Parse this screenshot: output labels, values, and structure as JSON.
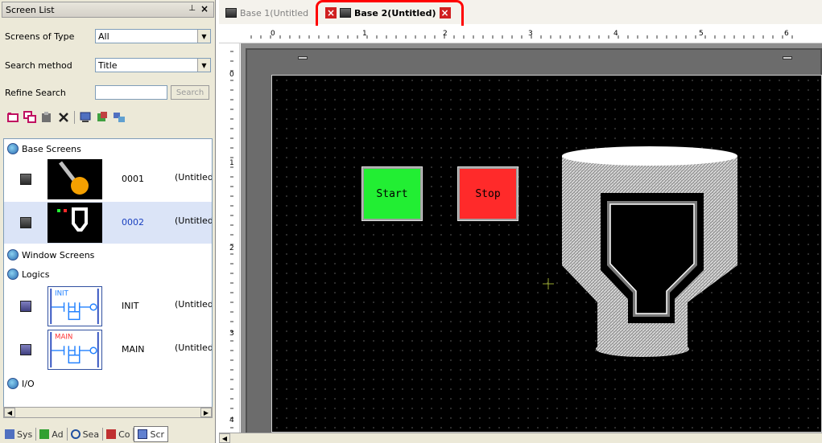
{
  "screen_list": {
    "title": "Screen List",
    "pin_icon": "pin-icon",
    "close_label": "×",
    "screens_of_type_label": "Screens of Type",
    "screens_of_type_value": "All",
    "search_method_label": "Search method",
    "search_method_value": "Title",
    "refine_search_label": "Refine Search",
    "refine_search_value": "",
    "search_button": "Search",
    "sections": {
      "base": "Base Screens",
      "window": "Window Screens",
      "logics": "Logics",
      "io": "I/O"
    },
    "base_screens": [
      {
        "number": "0001",
        "title": "(Untitled)"
      },
      {
        "number": "0002",
        "title": "(Untitled)"
      }
    ],
    "logics": [
      {
        "number": "INIT",
        "title": "(Untitled)",
        "thumb_label": "INIT"
      },
      {
        "number": "MAIN",
        "title": "(Untitled)",
        "thumb_label": "MAIN"
      }
    ],
    "bottom_tabs": [
      "Sys",
      "Ad",
      "Sea",
      "Co",
      "Scr"
    ]
  },
  "editor": {
    "tabs": [
      {
        "label": "Base 1(Untitled"
      },
      {
        "label": "Base 2(Untitled)"
      }
    ],
    "ruler_h": [
      "0",
      "1",
      "2",
      "3",
      "4",
      "5",
      "6"
    ],
    "ruler_v": [
      "0",
      "1",
      "2",
      "3",
      "4"
    ],
    "start_button": "Start",
    "stop_button": "Stop"
  },
  "colors": {
    "highlight": "#ff0000",
    "start": "#22ee33",
    "stop": "#ff2a2a"
  }
}
